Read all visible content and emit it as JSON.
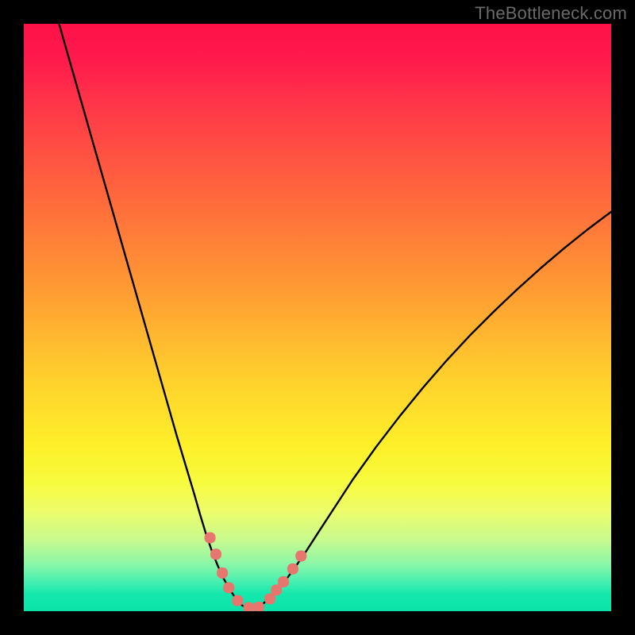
{
  "watermark": "TheBottleneck.com",
  "colors": {
    "frame": "#000000",
    "curve_stroke": "#000000",
    "marker_fill": "#e6766e",
    "marker_stroke": "#e6766e",
    "gradient_top": "#ff1148",
    "gradient_bottom": "#09e3a9"
  },
  "chart_data": {
    "type": "line",
    "title": "",
    "xlabel": "",
    "ylabel": "",
    "xlim": [
      0,
      100
    ],
    "ylim": [
      0,
      100
    ],
    "grid": false,
    "legend": false,
    "series": [
      {
        "name": "left-curve",
        "x": [
          6,
          8,
          10,
          12,
          14,
          16,
          18,
          20,
          22,
          24,
          26,
          27.5,
          29,
          30,
          31,
          32,
          33,
          34,
          35,
          36,
          37
        ],
        "y": [
          100,
          93,
          86,
          79,
          72,
          65,
          58,
          51,
          44,
          37,
          30,
          25,
          20,
          16.5,
          13.2,
          10.3,
          7.8,
          5.6,
          3.8,
          2.3,
          1.1
        ]
      },
      {
        "name": "trough",
        "x": [
          37,
          38,
          39,
          40
        ],
        "y": [
          1.1,
          0.5,
          0.4,
          0.7
        ]
      },
      {
        "name": "right-curve",
        "x": [
          40,
          42,
          44,
          46,
          48,
          50,
          53,
          56,
          60,
          64,
          68,
          72,
          76,
          80,
          84,
          88,
          92,
          96,
          100
        ],
        "y": [
          0.7,
          2.3,
          4.5,
          7.2,
          10.1,
          13.2,
          17.8,
          22.4,
          28.0,
          33.2,
          38.1,
          42.7,
          47.0,
          51.0,
          54.8,
          58.4,
          61.8,
          65.0,
          68.0
        ]
      }
    ],
    "markers": [
      {
        "x": 31.7,
        "y": 12.5
      },
      {
        "x": 32.7,
        "y": 9.7
      },
      {
        "x": 33.8,
        "y": 6.5
      },
      {
        "x": 34.9,
        "y": 4.0
      },
      {
        "x": 36.4,
        "y": 1.8
      },
      {
        "x": 38.3,
        "y": 0.6
      },
      {
        "x": 40.0,
        "y": 0.7
      },
      {
        "x": 41.9,
        "y": 2.1
      },
      {
        "x": 43.0,
        "y": 3.6
      },
      {
        "x": 44.2,
        "y": 5.0
      },
      {
        "x": 45.8,
        "y": 7.2
      },
      {
        "x": 47.2,
        "y": 9.4
      }
    ],
    "marker_style": {
      "shape": "rounded-square",
      "size": 14
    }
  }
}
